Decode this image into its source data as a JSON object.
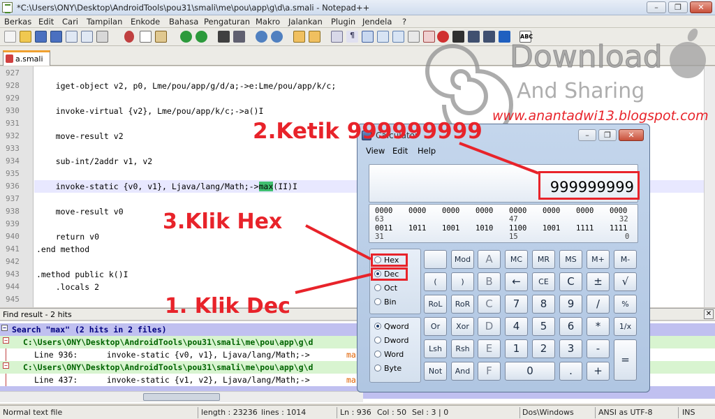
{
  "window": {
    "title": "*C:\\Users\\ONY\\Desktop\\AndroidTools\\pou31\\smali\\me\\pou\\app\\g\\d\\a.smali - Notepad++"
  },
  "menu": [
    "Berkas",
    "Edit",
    "Cari",
    "Tampilan",
    "Enkode",
    "Bahasa",
    "Pengaturan",
    "Makro",
    "Jalankan",
    "Plugin",
    "Jendela",
    "?"
  ],
  "tab": {
    "label": "a.smali"
  },
  "editor": {
    "lines": [
      {
        "num": "927",
        "code": ""
      },
      {
        "num": "928",
        "code": "    iget-object v2, p0, Lme/pou/app/g/d/a;->e:Lme/pou/app/k/c;"
      },
      {
        "num": "929",
        "code": ""
      },
      {
        "num": "930",
        "code": "    invoke-virtual {v2}, Lme/pou/app/k/c;->a()I"
      },
      {
        "num": "931",
        "code": ""
      },
      {
        "num": "932",
        "code": "    move-result v2"
      },
      {
        "num": "933",
        "code": ""
      },
      {
        "num": "934",
        "code": "    sub-int/2addr v1, v2"
      },
      {
        "num": "935",
        "code": ""
      },
      {
        "num": "936",
        "code_pre": "    invoke-static {v0, v1}, Ljava/lang/Math;->",
        "code_hl": "max",
        "code_post": "(II)I"
      },
      {
        "num": "937",
        "code": ""
      },
      {
        "num": "938",
        "code": "    move-result v0"
      },
      {
        "num": "939",
        "code": ""
      },
      {
        "num": "940",
        "code": "    return v0"
      },
      {
        "num": "941",
        "code": ".end method"
      },
      {
        "num": "942",
        "code": ""
      },
      {
        "num": "943",
        "code": ".method public k()I"
      },
      {
        "num": "944",
        "code": "    .locals 2"
      },
      {
        "num": "945",
        "code": ""
      }
    ]
  },
  "find": {
    "header": "Find result - 2 hits",
    "search": "Search \"max\" (2 hits in 2 files)",
    "file1": "C:\\Users\\ONY\\Desktop\\AndroidTools\\pou31\\smali\\me\\pou\\app\\g\\d",
    "hit1_pre": "Line 936:      invoke-static {v0, v1}, Ljava/lang/Math;->",
    "hit1_hl": "ma",
    "file2": "C:\\Users\\ONY\\Desktop\\AndroidTools\\pou31\\smali\\me\\pou\\app\\g\\d",
    "hit2_pre": "Line 437:      invoke-static {v1, v2}, Ljava/lang/Math;->",
    "hit2_hl": "ma"
  },
  "status": {
    "type": "Normal text file",
    "length": "length : 23236",
    "lines": "lines : 1014",
    "ln": "Ln : 936",
    "col": "Col : 50",
    "sel": "Sel : 3 | 0",
    "eol": "Dos\\Windows",
    "enc": "ANSI as UTF-8",
    "ins": "INS"
  },
  "watermark": {
    "line1": "Download",
    "line2": "And Sharing",
    "url": "www.anantadwi13.blogspot.com"
  },
  "calculator": {
    "title": "Calculator",
    "menu": [
      "View",
      "Edit",
      "Help"
    ],
    "display": "999999999",
    "bits": {
      "row1": [
        "0000",
        "0000",
        "0000",
        "0000",
        "0000",
        "0000",
        "0000",
        "0000"
      ],
      "row1_labels": [
        "63",
        "47",
        "32"
      ],
      "row2": [
        "0011",
        "1011",
        "1001",
        "1010",
        "1100",
        "1001",
        "1111",
        "1111"
      ],
      "row2_labels": [
        "31",
        "15",
        "0"
      ]
    },
    "radix": [
      "Hex",
      "Dec",
      "Oct",
      "Bin"
    ],
    "radix_selected": "Dec",
    "wordsize": [
      "Qword",
      "Dword",
      "Word",
      "Byte"
    ],
    "wordsize_selected": "Qword",
    "buttons": {
      "r1": [
        "",
        "Mod",
        "A",
        "MC",
        "MR",
        "MS",
        "M+",
        "M-"
      ],
      "r2": [
        "(",
        ")",
        "B",
        "←",
        "CE",
        "C",
        "±",
        "√"
      ],
      "r3": [
        "RoL",
        "RoR",
        "C",
        "7",
        "8",
        "9",
        "/",
        "%"
      ],
      "r4": [
        "Or",
        "Xor",
        "D",
        "4",
        "5",
        "6",
        "*",
        "1/x"
      ],
      "r5": [
        "Lsh",
        "Rsh",
        "E",
        "1",
        "2",
        "3",
        "-"
      ],
      "r6": [
        "Not",
        "And",
        "F",
        "0",
        ".",
        "+"
      ],
      "equals": "="
    }
  },
  "annotations": {
    "a1": "1. Klik Dec",
    "a2": "2.Ketik 999999999",
    "a3": "3.Klik Hex"
  }
}
